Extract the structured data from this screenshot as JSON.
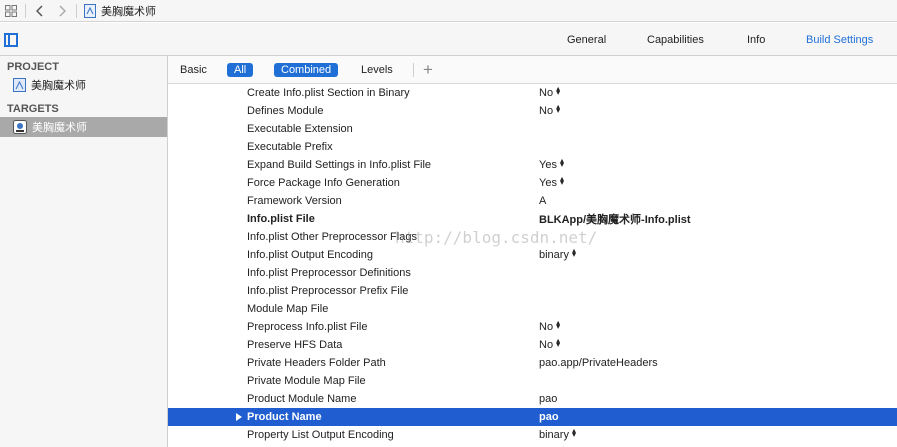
{
  "jumpbar": {
    "file_name": "美胸魔术师"
  },
  "header": {
    "tabs": [
      {
        "label": "General"
      },
      {
        "label": "Capabilities"
      },
      {
        "label": "Info"
      },
      {
        "label": "Build Settings"
      }
    ],
    "active_tab": "Build Settings"
  },
  "sidebar": {
    "project_title": "PROJECT",
    "project_item": "美胸魔术师",
    "targets_title": "TARGETS",
    "target_item": "美胸魔术师"
  },
  "filterbar": {
    "basic": "Basic",
    "all": "All",
    "combined": "Combined",
    "levels": "Levels",
    "add": "+"
  },
  "watermark": "http://blog.csdn.net/",
  "settings": [
    {
      "name": "Create Info.plist Section in Binary",
      "value": "No",
      "stepper": true
    },
    {
      "name": "Defines Module",
      "value": "No",
      "stepper": true
    },
    {
      "name": "Executable Extension",
      "value": ""
    },
    {
      "name": "Executable Prefix",
      "value": ""
    },
    {
      "name": "Expand Build Settings in Info.plist File",
      "value": "Yes",
      "stepper": true
    },
    {
      "name": "Force Package Info Generation",
      "value": "Yes",
      "stepper": true
    },
    {
      "name": "Framework Version",
      "value": "A"
    },
    {
      "name": "Info.plist File",
      "value": "BLKApp/美胸魔术师-Info.plist",
      "bold": true
    },
    {
      "name": "Info.plist Other Preprocessor Flags",
      "value": ""
    },
    {
      "name": "Info.plist Output Encoding",
      "value": "binary",
      "stepper": true
    },
    {
      "name": "Info.plist Preprocessor Definitions",
      "value": ""
    },
    {
      "name": "Info.plist Preprocessor Prefix File",
      "value": ""
    },
    {
      "name": "Module Map File",
      "value": ""
    },
    {
      "name": "Preprocess Info.plist File",
      "value": "No",
      "stepper": true
    },
    {
      "name": "Preserve HFS Data",
      "value": "No",
      "stepper": true
    },
    {
      "name": "Private Headers Folder Path",
      "value": "pao.app/PrivateHeaders"
    },
    {
      "name": "Private Module Map File",
      "value": ""
    },
    {
      "name": "Product Module Name",
      "value": "pao"
    },
    {
      "name": "Product Name",
      "value": "pao",
      "bold": true,
      "selected": true
    },
    {
      "name": "Property List Output Encoding",
      "value": "binary",
      "stepper": true
    }
  ],
  "colors": {
    "accent": "#1f6fd6",
    "selection": "#1f5dd0",
    "sidebar_selection": "#a9a9a9"
  }
}
